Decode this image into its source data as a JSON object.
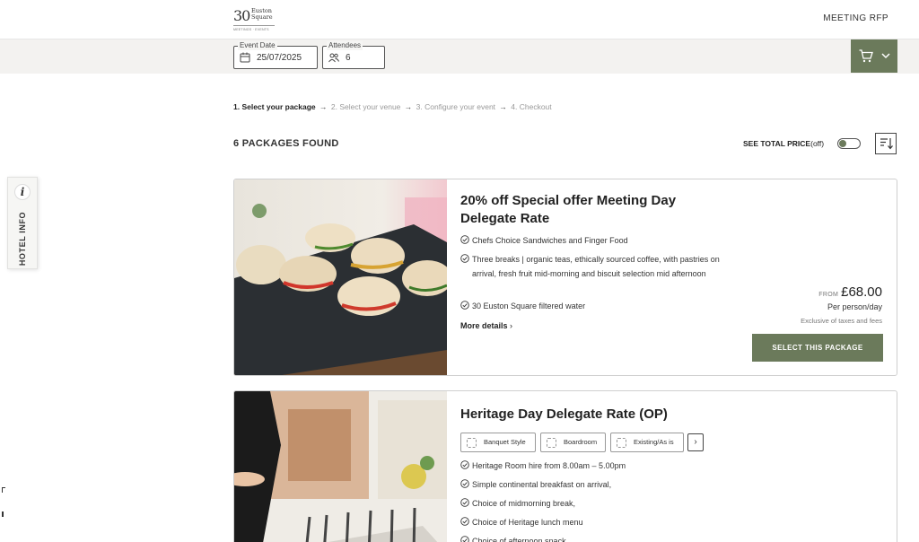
{
  "brand": {
    "number": "30",
    "name_line1": "Euston",
    "name_line2": "Square",
    "tagline": "MEETINGS · EVENTS"
  },
  "header": {
    "nav_label": "MEETING RFP"
  },
  "filters": {
    "event_date": {
      "label": "Event Date",
      "value": "25/07/2025",
      "icon": "calendar-icon"
    },
    "attendees": {
      "label": "Attendees",
      "value": "6",
      "icon": "people-icon"
    }
  },
  "cart": {
    "icon": "cart-icon",
    "dropdown_icon": "chevron-down-icon",
    "accent": "#6b7a5b"
  },
  "side_tab": {
    "icon_glyph": "i",
    "label": "HOTEL INFO"
  },
  "steps": [
    {
      "label": "1. Select your package",
      "active": true
    },
    {
      "label": "2. Select your venue",
      "active": false
    },
    {
      "label": "3. Configure your event",
      "active": false
    },
    {
      "label": "4. Checkout",
      "active": false
    }
  ],
  "steps_arrow": "→",
  "results": {
    "count_label": "6 PACKAGES FOUND",
    "total_price_label": "SEE TOTAL PRICE",
    "total_price_state": "(off)",
    "sort_icon": "sort-icon"
  },
  "packages": [
    {
      "title": "20% off Special offer Meeting Day Delegate Rate",
      "features": [
        "Chefs Choice Sandwiches and Finger Food",
        "Three breaks | organic teas, ethically sourced coffee, with pastries on arrival, fresh fruit mid-morning and biscuit selection mid afternoon",
        "30 Euston Square filtered water"
      ],
      "more_label": "More details",
      "more_chevron": "›",
      "price_from_label": "FROM",
      "price": "£68.00",
      "price_unit": "Per person/day",
      "price_note": "Exclusive of taxes and fees",
      "select_label": "SELECT THIS PACKAGE"
    },
    {
      "title": "Heritage Day Delegate Rate (OP)",
      "layouts": [
        "Banquet Style",
        "Boardroom",
        "Existing/As is"
      ],
      "layouts_next": "›",
      "features": [
        "Heritage Room hire from 8.00am – 5.00pm",
        "Simple continental breakfast on arrival,",
        "Choice of midmorning break,",
        "Choice of Heritage lunch menu",
        "Choice of afternoon snack"
      ]
    }
  ]
}
